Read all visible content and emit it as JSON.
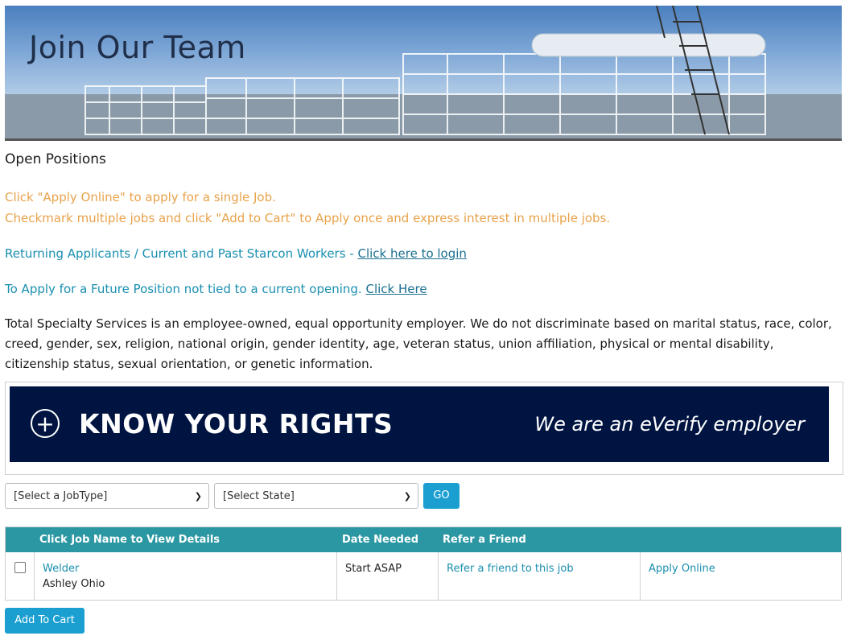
{
  "banner": {
    "title": "Join Our Team"
  },
  "section_title": "Open Positions",
  "instructions": {
    "line1": "Click \"Apply Online\" to apply for a single Job.",
    "line2": "Checkmark multiple jobs and click \"Add to Cart\" to Apply once and express interest in multiple jobs."
  },
  "returning": {
    "text": "Returning Applicants / Current and Past Starcon Workers - ",
    "link": "Click here to login"
  },
  "future": {
    "text": "To Apply for a Future Position not tied to a current opening. ",
    "link": "Click Here"
  },
  "eeo_statement": "Total Specialty Services is an employee-owned, equal opportunity employer. We do not discriminate based on marital status, race, color, creed, gender, sex, religion, national origin, gender identity, age, veteran status, union affiliation, physical or mental disability, citizenship status, sexual orientation, or genetic information.",
  "rights_banner": {
    "title": "KNOW YOUR RIGHTS",
    "everify": "We are an eVerify employer",
    "icon": "plus-circle-icon"
  },
  "filters": {
    "jobtype": "[Select a JobType]",
    "state": "[Select State]",
    "go": "GO"
  },
  "table": {
    "headers": {
      "job": "Click Job Name to View Details",
      "date": "Date Needed",
      "refer": "Refer a Friend"
    },
    "rows": [
      {
        "job": "Welder",
        "location": "Ashley Ohio",
        "date": "Start ASAP",
        "refer": "Refer a friend to this job",
        "apply": "Apply Online"
      }
    ]
  },
  "add_to_cart": "Add To Cart",
  "colors": {
    "accent": "#1a9fd0",
    "header": "#2b97a3",
    "orange": "#e8a24a",
    "navy": "#001442"
  }
}
